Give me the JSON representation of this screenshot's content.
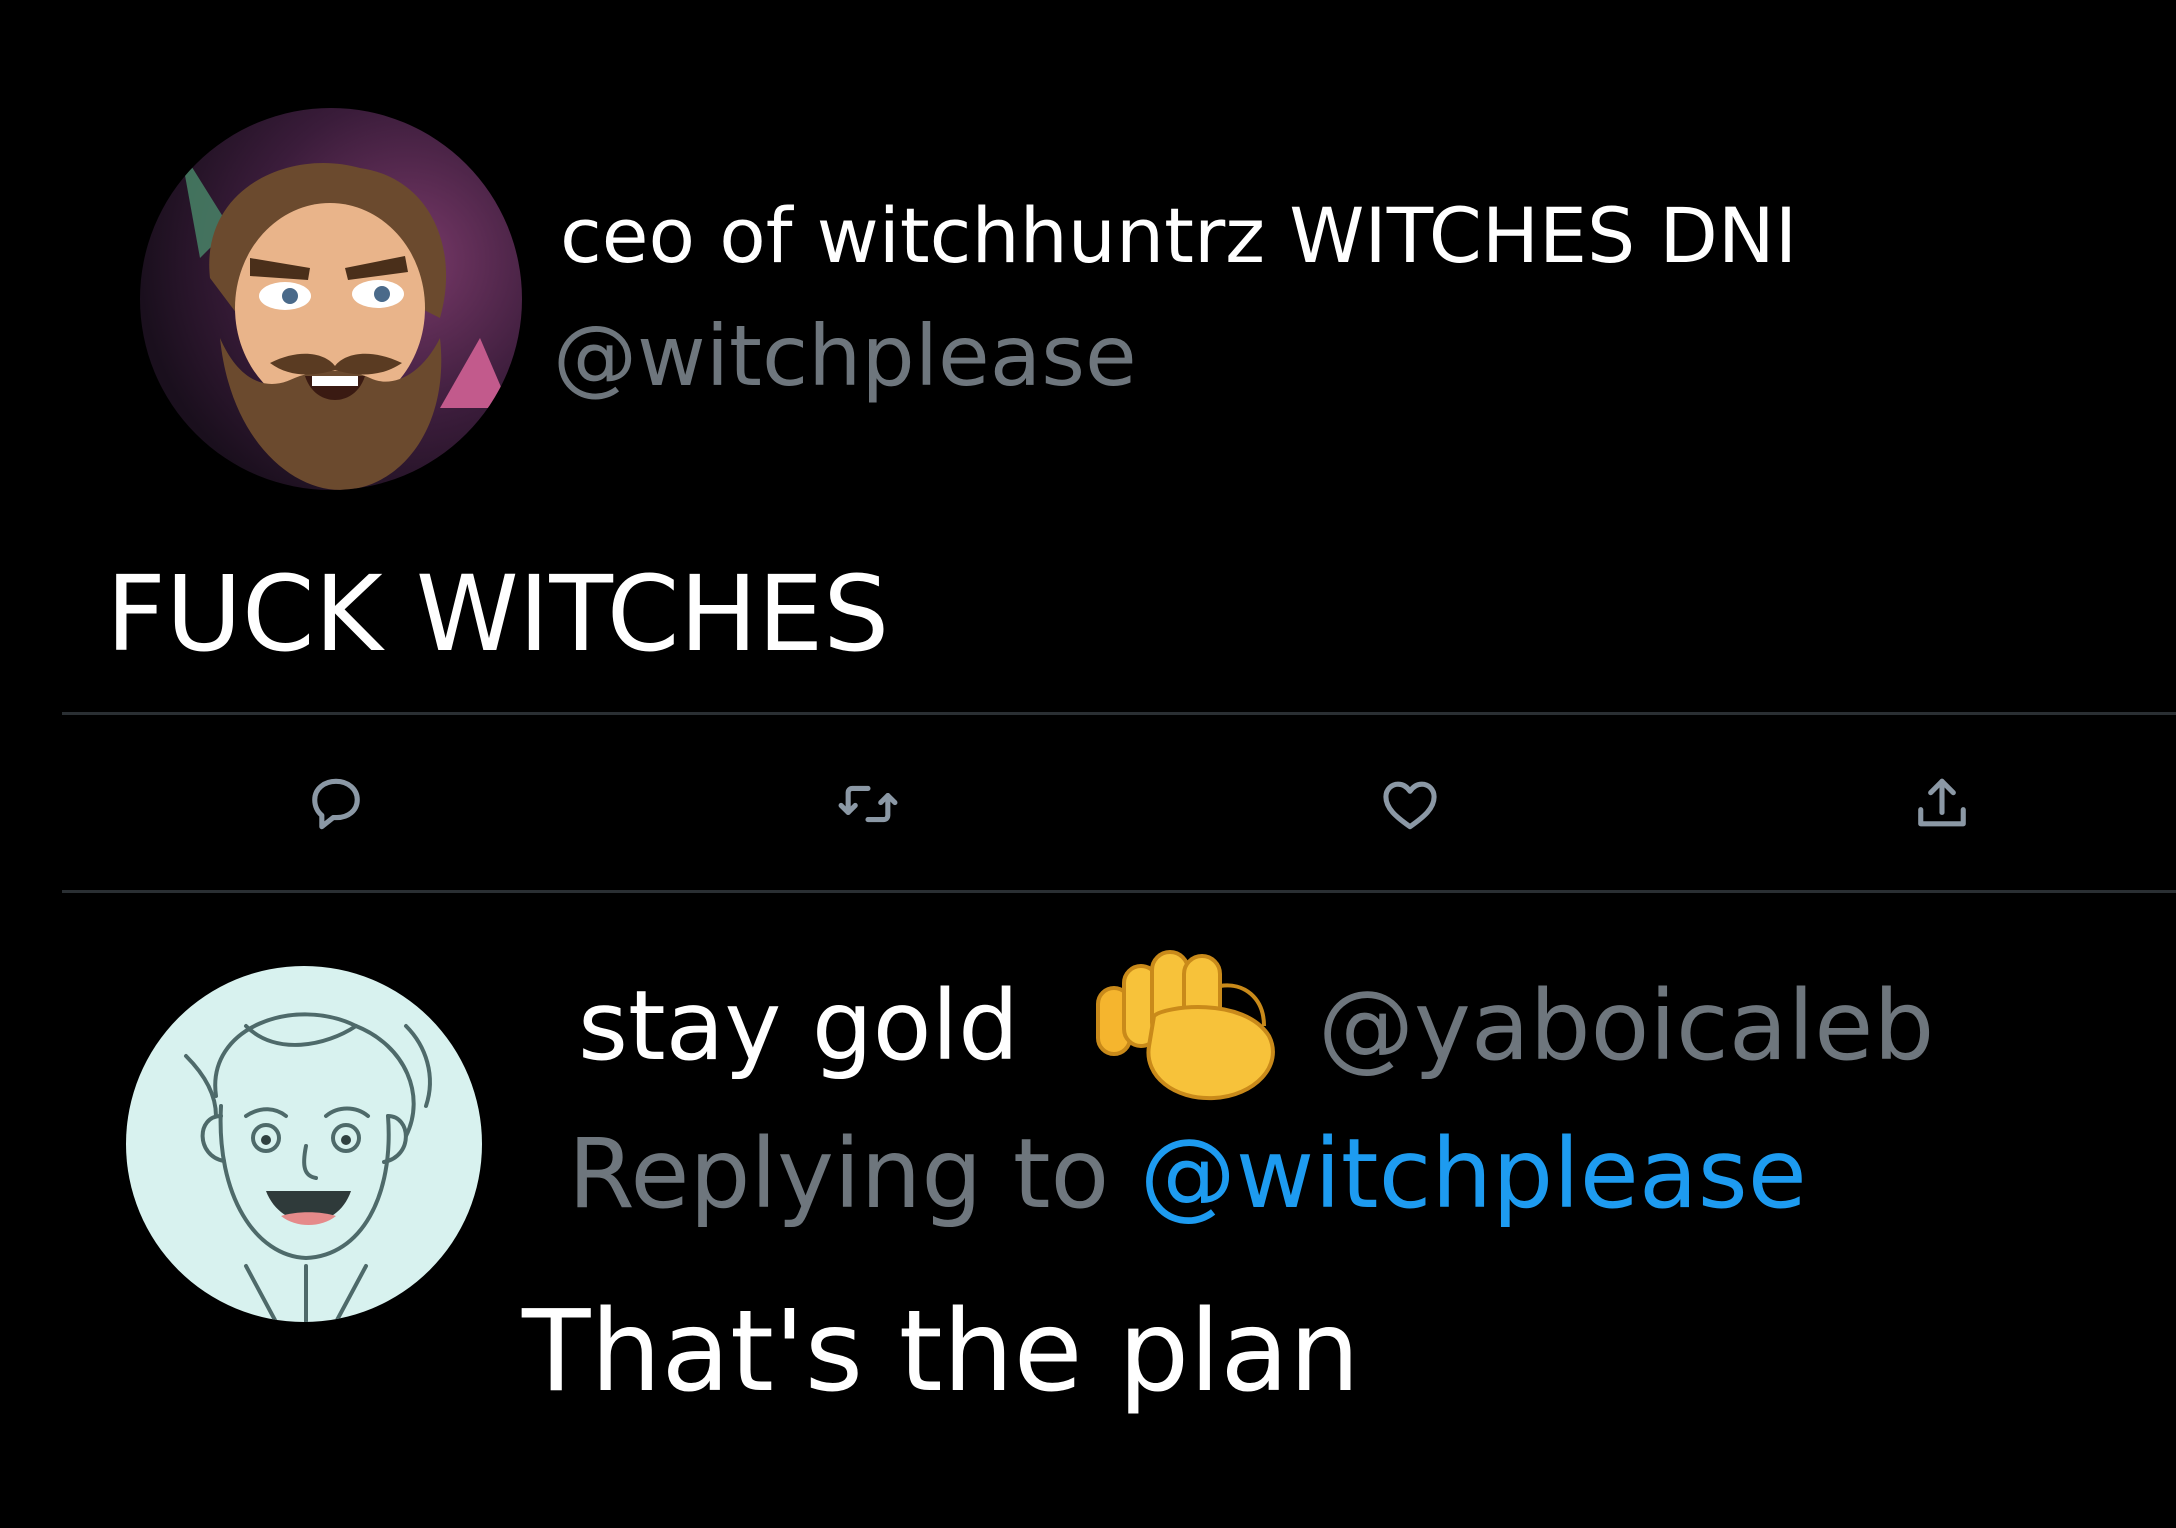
{
  "tweet": {
    "display_name": "ceo of witchhuntrz WITCHES DNI",
    "handle": "@witchplease",
    "text": "FUCK WITCHES",
    "avatar_icon": "bearded-cartoon-man-avatar",
    "actions": [
      {
        "name": "reply",
        "icon": "speech-bubble-icon"
      },
      {
        "name": "retweet",
        "icon": "retweet-arrows-icon"
      },
      {
        "name": "like",
        "icon": "heart-icon"
      },
      {
        "name": "share",
        "icon": "share-arrow-icon"
      }
    ]
  },
  "reply": {
    "display_name": "stay gold",
    "name_emoji": "raised-fist-emoji",
    "handle": "@yaboicaleb",
    "replying_label": "Replying to",
    "replying_handle": "@witchplease",
    "text": "That's the plan",
    "avatar_icon": "sketched-smiling-boy-avatar"
  },
  "colors": {
    "background": "#000000",
    "text_primary": "#ffffff",
    "text_secondary": "#6e767d",
    "link": "#1d9bf0",
    "divider": "#2a2f33",
    "icon": "#8b98a5"
  }
}
